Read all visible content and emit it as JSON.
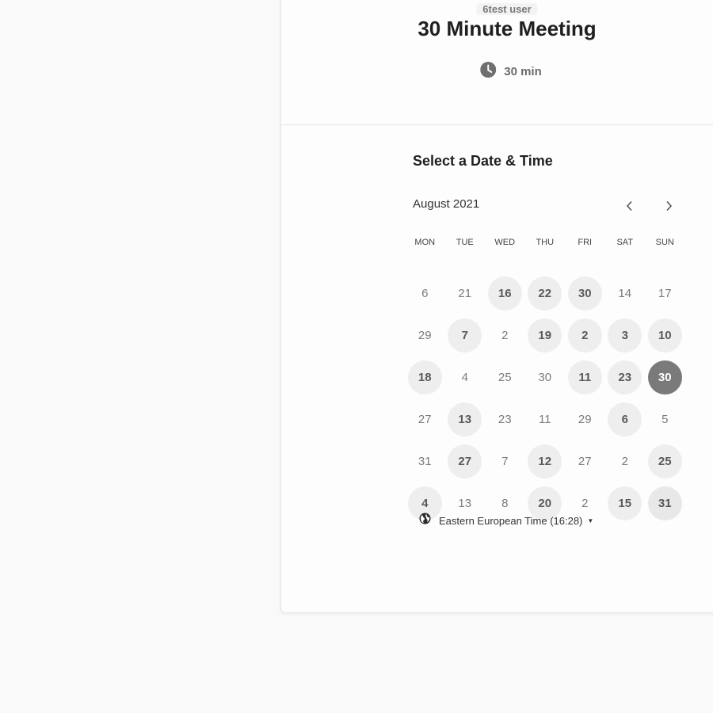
{
  "event": {
    "host": "6test user",
    "title": "30 Minute Meeting",
    "duration": "30 min"
  },
  "scheduler": {
    "heading": "Select a Date & Time",
    "month": "August 2021",
    "weekdays": [
      "MON",
      "TUE",
      "WED",
      "THU",
      "FRI",
      "SAT",
      "SUN"
    ],
    "weeks": [
      [
        {
          "d": "6",
          "s": "unavailable"
        },
        {
          "d": "21",
          "s": "unavailable"
        },
        {
          "d": "16",
          "s": "available"
        },
        {
          "d": "22",
          "s": "available"
        },
        {
          "d": "30",
          "s": "available"
        },
        {
          "d": "14",
          "s": "unavailable"
        },
        {
          "d": "17",
          "s": "unavailable"
        }
      ],
      [
        {
          "d": "29",
          "s": "unavailable"
        },
        {
          "d": "7",
          "s": "available"
        },
        {
          "d": "2",
          "s": "unavailable"
        },
        {
          "d": "19",
          "s": "available"
        },
        {
          "d": "2",
          "s": "available"
        },
        {
          "d": "3",
          "s": "available"
        },
        {
          "d": "10",
          "s": "available"
        }
      ],
      [
        {
          "d": "18",
          "s": "available"
        },
        {
          "d": "4",
          "s": "unavailable"
        },
        {
          "d": "25",
          "s": "unavailable"
        },
        {
          "d": "30",
          "s": "unavailable"
        },
        {
          "d": "11",
          "s": "available"
        },
        {
          "d": "23",
          "s": "available"
        },
        {
          "d": "30",
          "s": "selected"
        }
      ],
      [
        {
          "d": "27",
          "s": "unavailable"
        },
        {
          "d": "13",
          "s": "available"
        },
        {
          "d": "23",
          "s": "unavailable"
        },
        {
          "d": "11",
          "s": "unavailable"
        },
        {
          "d": "29",
          "s": "unavailable"
        },
        {
          "d": "6",
          "s": "available"
        },
        {
          "d": "5",
          "s": "unavailable"
        }
      ],
      [
        {
          "d": "31",
          "s": "unavailable"
        },
        {
          "d": "27",
          "s": "available"
        },
        {
          "d": "7",
          "s": "unavailable"
        },
        {
          "d": "12",
          "s": "available"
        },
        {
          "d": "27",
          "s": "unavailable"
        },
        {
          "d": "2",
          "s": "unavailable"
        },
        {
          "d": "25",
          "s": "available"
        }
      ],
      [
        {
          "d": "4",
          "s": "available"
        },
        {
          "d": "13",
          "s": "unavailable"
        },
        {
          "d": "8",
          "s": "unavailable"
        },
        {
          "d": "20",
          "s": "available"
        },
        {
          "d": "2",
          "s": "unavailable"
        },
        {
          "d": "15",
          "s": "available"
        },
        {
          "d": "31",
          "s": "today"
        }
      ]
    ],
    "timezone": "Eastern European Time (16:28)"
  },
  "icons": {
    "duration": "clock-icon",
    "prev": "chevron-left-icon",
    "next": "chevron-right-icon",
    "timezone": "globe-icon",
    "dropdown": "caret-down-icon"
  },
  "colors": {
    "page_bg": "#f9f9f9",
    "available_bg": "#eeeeee",
    "selected_bg": "#7a7a7a"
  }
}
